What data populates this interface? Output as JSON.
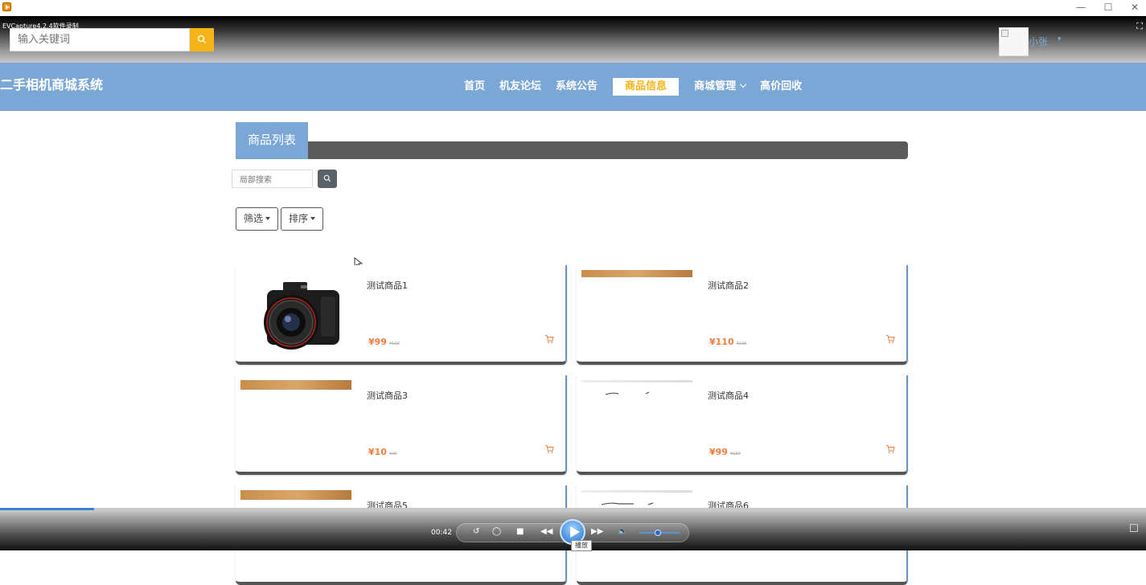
{
  "window": {
    "minimize": "—",
    "maximize": "☐",
    "close": "✕"
  },
  "overlay": {
    "title": "EVCapture4.2.4软件录制"
  },
  "header": {
    "search_placeholder": "输入关键词",
    "user_name": "小张",
    "user_caret": "▾"
  },
  "navbar": {
    "brand": "二手相机商城系统",
    "items": [
      {
        "label": "首页"
      },
      {
        "label": "机友论坛"
      },
      {
        "label": "系统公告"
      },
      {
        "label": "商品信息",
        "active": true
      },
      {
        "label": "商城管理",
        "dropdown": true
      },
      {
        "label": "高价回收"
      }
    ]
  },
  "section": {
    "title": "商品列表"
  },
  "toolbar": {
    "local_search_placeholder": "局部搜索",
    "filter_label": "筛选",
    "sort_label": "排序"
  },
  "products": [
    {
      "name": "测试商品1",
      "price": "¥99",
      "original": "¥110",
      "image": "camera"
    },
    {
      "name": "测试商品2",
      "price": "¥110",
      "original": "¥220",
      "image": "strip"
    },
    {
      "name": "测试商品3",
      "price": "¥10",
      "original": "¥20",
      "image": "strip"
    },
    {
      "name": "测试商品4",
      "price": "¥99",
      "original": "¥100",
      "image": "gray"
    },
    {
      "name": "测试商品5",
      "price": "",
      "original": "",
      "image": "strip"
    },
    {
      "name": "测试商品6",
      "price": "",
      "original": "",
      "image": "gray"
    }
  ],
  "player": {
    "time": "00:42",
    "progress_fraction": 0.082,
    "volume_fraction": 0.45,
    "tooltip": "播放"
  },
  "colors": {
    "nav_blue": "#7ba7d7",
    "accent_yellow": "#f5b417",
    "price_orange": "#f07e3e",
    "dark_bar": "#5a5a5a"
  }
}
